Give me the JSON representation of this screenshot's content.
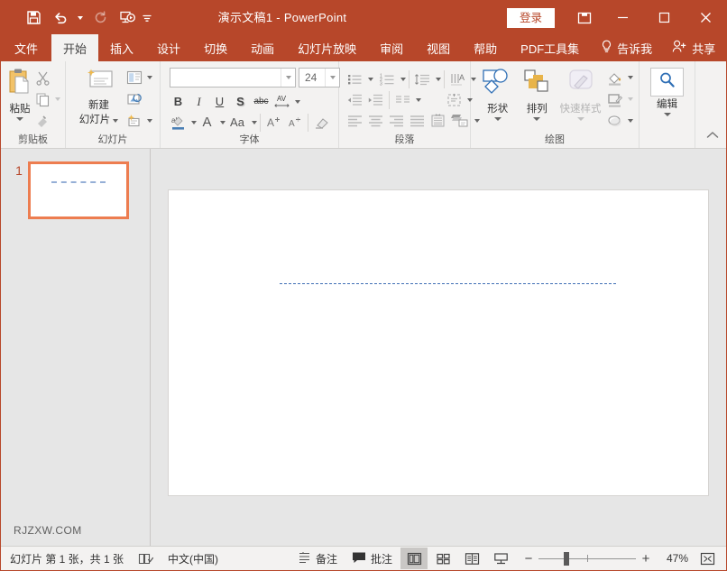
{
  "window": {
    "title": "演示文稿1  -  PowerPoint",
    "signin_label": "登录",
    "ribbon_display_icon": "ribbon-display-options-icon",
    "minimize_icon": "minimize-icon",
    "maximize_icon": "maximize-icon",
    "close_icon": "close-icon"
  },
  "quick_access": [
    {
      "name": "save",
      "icon": "save-icon"
    },
    {
      "name": "undo",
      "icon": "undo-icon",
      "has_caret": true
    },
    {
      "name": "redo",
      "icon": "redo-icon",
      "disabled": true
    },
    {
      "name": "start-from-beginning",
      "icon": "start-slideshow-icon"
    },
    {
      "name": "customize-quick-access-toolbar",
      "icon": "chevron-down-icon"
    }
  ],
  "tabs": [
    {
      "label": "文件",
      "active": false
    },
    {
      "label": "开始",
      "active": true
    },
    {
      "label": "插入",
      "active": false
    },
    {
      "label": "设计",
      "active": false
    },
    {
      "label": "切换",
      "active": false
    },
    {
      "label": "动画",
      "active": false
    },
    {
      "label": "幻灯片放映",
      "active": false
    },
    {
      "label": "审阅",
      "active": false
    },
    {
      "label": "视图",
      "active": false
    },
    {
      "label": "帮助",
      "active": false
    },
    {
      "label": "PDF工具集",
      "active": false
    }
  ],
  "tell_me": {
    "label": "告诉我",
    "icon": "lightbulb-icon"
  },
  "share": {
    "label": "共享",
    "icon": "person-add-icon"
  },
  "ribbon": {
    "groups": [
      {
        "label": "剪贴板",
        "has_launcher": true,
        "buttons": {
          "paste": "粘贴",
          "cut": "cut-icon",
          "copy": "copy-icon",
          "format_painter": "format-painter-icon"
        }
      },
      {
        "label": "幻灯片",
        "has_launcher": false,
        "buttons": {
          "new_slide": "新建\n幻灯片",
          "new_slide_line1": "新建",
          "new_slide_line2": "幻灯片",
          "layout": "layout-icon",
          "reset": "reset-icon",
          "section": "section-icon"
        }
      },
      {
        "label": "字体",
        "has_launcher": true,
        "font_name": "",
        "font_name_placeholder": "",
        "font_size": "24",
        "buttons": {
          "bold": "B",
          "italic": "I",
          "underline": "U",
          "shadow": "S",
          "strikethrough": "abc",
          "character_spacing": "AV",
          "text_highlight": "text-highlight-icon",
          "font_color": "A",
          "change_case": "Aa",
          "increase_font_size": "A",
          "decrease_font_size": "A",
          "clear_formatting": "clear-formatting-icon"
        }
      },
      {
        "label": "段落",
        "has_launcher": true,
        "buttons": {
          "bullets": "bullets-icon",
          "numbering": "numbering-icon",
          "line_spacing": "line-spacing-icon",
          "text_direction": "text-direction-icon",
          "decrease_indent": "decrease-indent-icon",
          "increase_indent": "increase-indent-icon",
          "columns": "columns-icon",
          "align_text": "align-text-icon",
          "align_left": "align-left-icon",
          "align_center": "align-center-icon",
          "align_right": "align-right-icon",
          "justify": "justify-icon",
          "distribute": "distribute-icon",
          "smartart": "smartart-icon"
        }
      },
      {
        "label": "绘图",
        "has_launcher": true,
        "buttons": {
          "shapes": "形状",
          "arrange": "排列",
          "quick_styles": "快速样式",
          "shape_fill": "shape-fill-icon",
          "shape_outline": "shape-outline-icon",
          "shape_effects": "shape-effects-icon"
        },
        "quick_styles_disabled": true
      },
      {
        "label": "",
        "has_launcher": false,
        "buttons": {
          "editing": "编辑",
          "editing_icon": "magnifier-icon"
        }
      }
    ],
    "collapse_icon": "chevron-up-icon"
  },
  "thumbnail_pane": {
    "slides": [
      {
        "number": "1",
        "selected": true
      }
    ],
    "watermark": "RJZXW.COM"
  },
  "slide_canvas": {
    "content_description": "dashed-blue-line"
  },
  "status_bar": {
    "slide_count_text": "幻灯片 第 1 张，共 1 张",
    "spellcheck_icon": "spellcheck-icon",
    "language": "中文(中国)",
    "notes_label": "备注",
    "notes_icon": "notes-icon",
    "comments_label": "批注",
    "comments_icon": "comment-icon",
    "views": [
      {
        "name": "normal-view",
        "icon": "normal-view-icon",
        "active": true
      },
      {
        "name": "slide-sorter-view",
        "icon": "slide-sorter-icon",
        "active": false
      },
      {
        "name": "reading-view",
        "icon": "reading-view-icon",
        "active": false
      },
      {
        "name": "slideshow-view",
        "icon": "slideshow-icon",
        "active": false
      }
    ],
    "zoom_out": "−",
    "zoom_in": "+",
    "zoom_level": "47%",
    "fit_icon": "fit-slide-to-window-icon"
  },
  "colors": {
    "brand": "#b7472a",
    "ribbon_bg": "#f3f2f1",
    "workspace": "#e6e6e6",
    "slide_selection": "#ed7d50",
    "dash_line": "#3f6fb5"
  }
}
